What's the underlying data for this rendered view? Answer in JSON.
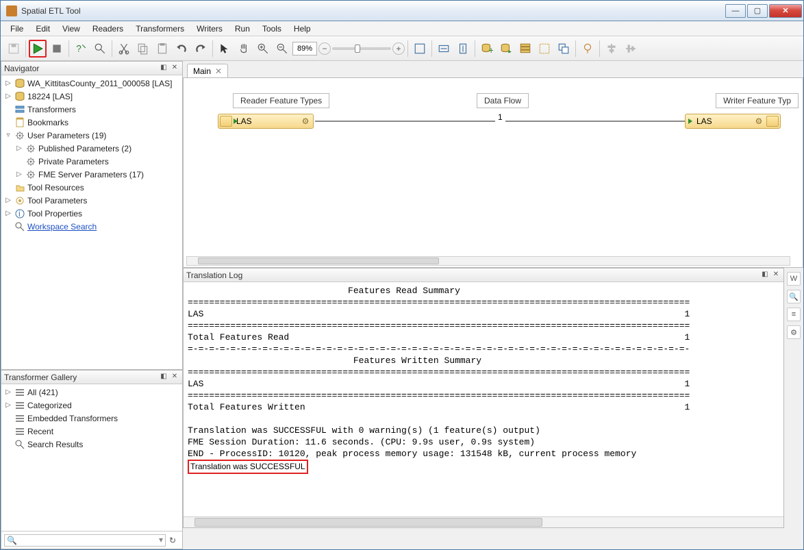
{
  "window": {
    "title": "Spatial ETL Tool"
  },
  "menu": {
    "file": "File",
    "edit": "Edit",
    "view": "View",
    "readers": "Readers",
    "transformers": "Transformers",
    "writers": "Writers",
    "run": "Run",
    "tools": "Tools",
    "help": "Help"
  },
  "toolbar": {
    "zoom": "89%"
  },
  "navigator": {
    "title": "Navigator",
    "items": [
      {
        "depth": 0,
        "tw": "▷",
        "icon": "db",
        "label": "WA_KittitasCounty_2011_000058 [LAS]"
      },
      {
        "depth": 0,
        "tw": "▷",
        "icon": "db",
        "label": "18224 [LAS]"
      },
      {
        "depth": 0,
        "tw": "",
        "icon": "tx",
        "label": "Transformers"
      },
      {
        "depth": 0,
        "tw": "",
        "icon": "bm",
        "label": "Bookmarks"
      },
      {
        "depth": 0,
        "tw": "▿",
        "icon": "gear",
        "label": "User Parameters (19)"
      },
      {
        "depth": 1,
        "tw": "▷",
        "icon": "pub",
        "label": "Published Parameters (2)"
      },
      {
        "depth": 1,
        "tw": "",
        "icon": "priv",
        "label": "Private Parameters"
      },
      {
        "depth": 1,
        "tw": "▷",
        "icon": "srv",
        "label": "FME Server Parameters (17)"
      },
      {
        "depth": 0,
        "tw": "",
        "icon": "res",
        "label": "Tool Resources"
      },
      {
        "depth": 0,
        "tw": "▷",
        "icon": "tp",
        "label": "Tool Parameters"
      },
      {
        "depth": 0,
        "tw": "▷",
        "icon": "prop",
        "label": "Tool Properties"
      },
      {
        "depth": 0,
        "tw": "",
        "icon": "sr",
        "label": "Workspace Search",
        "link": true
      }
    ]
  },
  "gallery": {
    "title": "Transformer Gallery",
    "items": [
      {
        "tw": "▷",
        "icon": "cat",
        "label": "All (421)"
      },
      {
        "tw": "▷",
        "icon": "cat",
        "label": "Categorized"
      },
      {
        "tw": "",
        "icon": "cat",
        "label": "Embedded Transformers"
      },
      {
        "tw": "",
        "icon": "cat",
        "label": "Recent"
      },
      {
        "tw": "",
        "icon": "sr",
        "label": "Search Results"
      }
    ]
  },
  "canvas": {
    "tab": "Main",
    "reader_label": "Reader Feature Types",
    "writer_label": "Writer Feature Typ",
    "flow_label": "Data Flow",
    "node_text": "LAS",
    "count": "1"
  },
  "log": {
    "title": "Translation Log",
    "lines": [
      "                              Features Read Summary",
      "==============================================================================================",
      "LAS                                                                                          1",
      "==============================================================================================",
      "Total Features Read                                                                          1",
      "=-=-=-=-=-=-=-=-=-=-=-=-=-=-=-=-=-=-=-=-=-=-=-=-=-=-=-=-=-=-=-=-=-=-=-=-=-=-=-=-=-=-=-=-=-=-=-",
      "                               Features Written Summary",
      "==============================================================================================",
      "LAS                                                                                          1",
      "==============================================================================================",
      "Total Features Written                                                                       1",
      "",
      "Translation was SUCCESSFUL with 0 warning(s) (1 feature(s) output)",
      "FME Session Duration: 11.6 seconds. (CPU: 9.9s user, 0.9s system)",
      "END - ProcessID: 10120, peak process memory usage: 131548 kB, current process memory"
    ],
    "highlight": "Translation was SUCCESSFUL"
  },
  "search": {
    "placeholder": ""
  }
}
